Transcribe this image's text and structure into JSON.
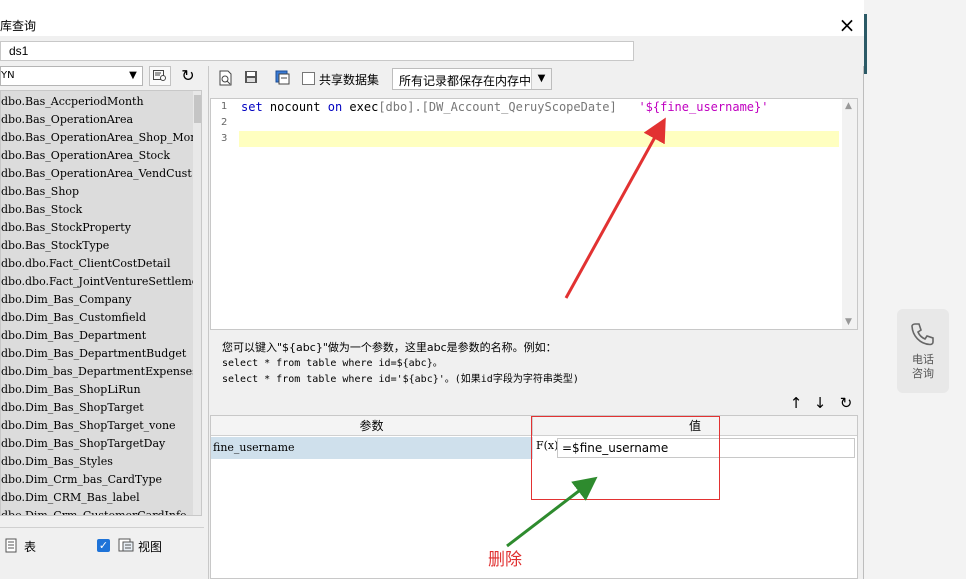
{
  "window": {
    "title": "库查询",
    "close": "×"
  },
  "dataset_name": "ds1",
  "left": {
    "db_select": "YN",
    "tables": [
      "dbo.Bas_AccperiodMonth",
      "dbo.Bas_OperationArea",
      "dbo.Bas_OperationArea_Shop_Month",
      "dbo.Bas_OperationArea_Stock",
      "dbo.Bas_OperationArea_VendCust",
      "dbo.Bas_Shop",
      "dbo.Bas_Stock",
      "dbo.Bas_StockProperty",
      "dbo.Bas_StockType",
      "dbo.dbo.Fact_ClientCostDetail",
      "dbo.dbo.Fact_JointVentureSettleme",
      "dbo.Dim_Bas_Company",
      "dbo.Dim_Bas_Customfield",
      "dbo.Dim_Bas_Department",
      "dbo.Dim_Bas_DepartmentBudget",
      "dbo.Dim_bas_DepartmentExpenses",
      "dbo.Dim_Bas_ShopLiRun",
      "dbo.Dim_Bas_ShopTarget",
      "dbo.Dim_Bas_ShopTarget_vone",
      "dbo.Dim_Bas_ShopTargetDay",
      "dbo.Dim_Bas_Styles",
      "dbo.Dim_Crm_bas_CardType",
      "dbo.Dim_CRM_Bas_label",
      "dbo.Dim_Crm_CustomerCardInfo"
    ],
    "table_label": "表",
    "view_label": "视图"
  },
  "toolbar": {
    "share_label": "共享数据集",
    "mode_select": "所有记录都保存在内存中"
  },
  "editor": {
    "line_numbers": [
      "1",
      "2",
      "3"
    ],
    "sql": {
      "kw_set": "set",
      "nocount": "nocount",
      "kw_on": "on",
      "exec": "exec",
      "proc": "[dbo].[DW_Account_QeruyScopeDate]",
      "param": "'${fine_username}'"
    }
  },
  "help": {
    "line1": "您可以键入\"${abc}\"做为一个参数，这里abc是参数的名称。例如：",
    "line2": "select * from table where id=${abc}。",
    "line3": "select * from table where id='${abc}'。(如果id字段为字符串类型)"
  },
  "params": {
    "col_param": "参数",
    "col_value": "值",
    "rows": [
      {
        "name": "fine_username",
        "formula": "F(x)",
        "value": "=$fine_username"
      }
    ]
  },
  "annotation": {
    "label": "删除"
  },
  "side_widget": {
    "line1": "电话",
    "line2": "咨询"
  },
  "colors": {
    "red": "#e23232",
    "green": "#2e8b2e",
    "selected_row": "#cfe0ec",
    "highlight": "#ffffc0"
  }
}
